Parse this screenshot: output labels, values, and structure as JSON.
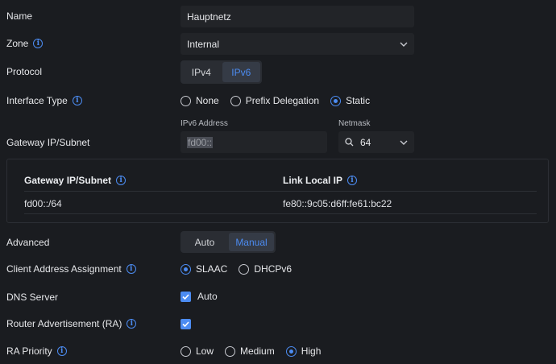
{
  "name": {
    "label": "Name",
    "value": "Hauptnetz"
  },
  "zone": {
    "label": "Zone",
    "value": "Internal"
  },
  "protocol": {
    "label": "Protocol",
    "options": [
      "IPv4",
      "IPv6"
    ],
    "selected": "IPv6"
  },
  "interface_type": {
    "label": "Interface Type",
    "options": [
      "None",
      "Prefix Delegation",
      "Static"
    ],
    "selected": "Static"
  },
  "gateway": {
    "label": "Gateway IP/Subnet",
    "ipv6_label": "IPv6 Address",
    "ipv6_value": "fd00::",
    "netmask_label": "Netmask",
    "netmask_value": "64"
  },
  "table": {
    "col1": "Gateway IP/Subnet",
    "col2": "Link Local IP",
    "row1": {
      "gateway": "fd00::/64",
      "link_local": "fe80::9c05:d6ff:fe61:bc22"
    }
  },
  "advanced": {
    "label": "Advanced",
    "options": [
      "Auto",
      "Manual"
    ],
    "selected": "Manual"
  },
  "client_assignment": {
    "label": "Client Address Assignment",
    "options": [
      "SLAAC",
      "DHCPv6"
    ],
    "selected": "SLAAC"
  },
  "dns": {
    "label": "DNS Server",
    "checkbox_label": "Auto",
    "checked": true
  },
  "router_adv": {
    "label": "Router Advertisement (RA)",
    "checked": true
  },
  "ra_priority": {
    "label": "RA Priority",
    "options": [
      "Low",
      "Medium",
      "High"
    ],
    "selected": "High"
  },
  "colors": {
    "accent": "#4c8cf2",
    "background": "#1a1c20",
    "field": "#222428"
  }
}
